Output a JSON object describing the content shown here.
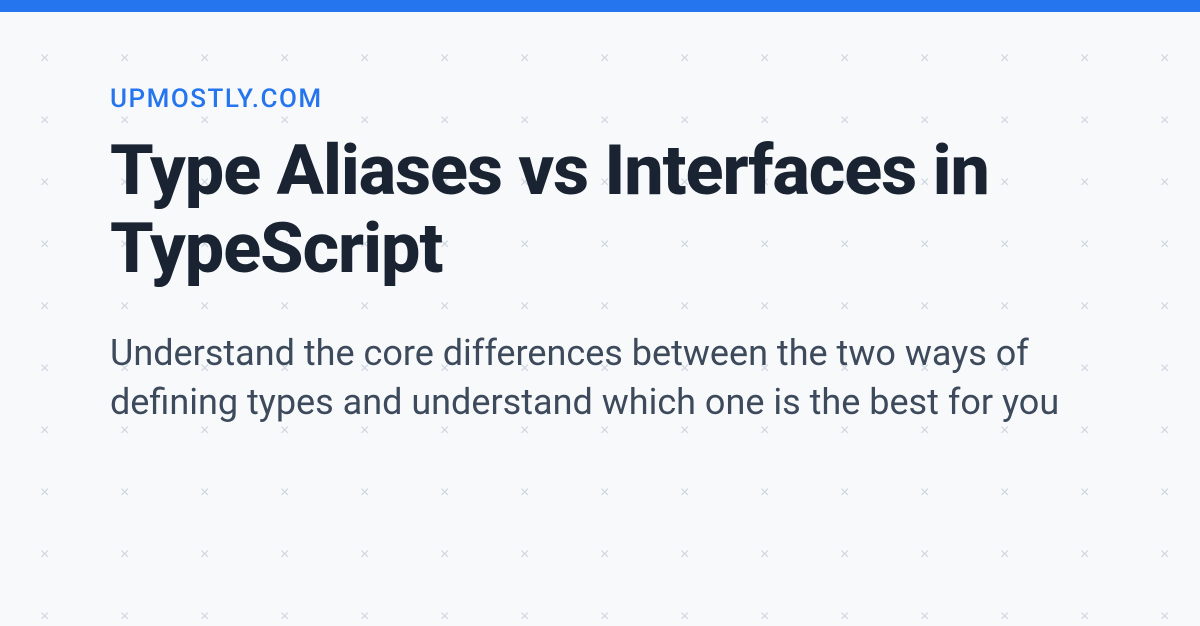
{
  "header": {
    "site_name": "UPMOSTLY.COM"
  },
  "article": {
    "title": "Type Aliases vs Interfaces in TypeScript",
    "description": "Understand the core differences between the two ways of defining types and understand which one is the best for you"
  },
  "colors": {
    "accent": "#2575ee",
    "title_color": "#1a2332",
    "text_color": "#3d4a5c",
    "background": "#f8f9fb",
    "pattern_color": "#cdd5df"
  }
}
